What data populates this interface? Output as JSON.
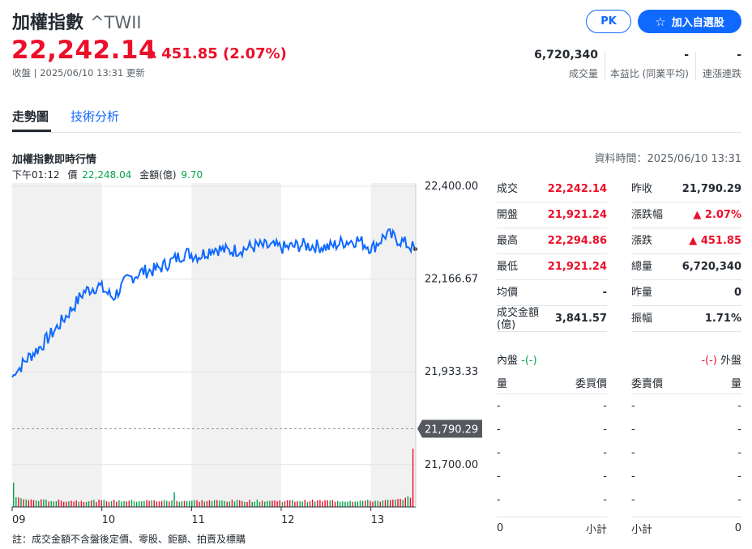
{
  "header": {
    "name": "加權指數",
    "symbol": "^TWII",
    "price": "22,242.14",
    "change_arrow": "▲",
    "change": "451.85 (2.07%)",
    "updated": "收盤 | 2025/06/10 13:31 更新",
    "pk_label": "PK",
    "add_icon": "star-outline-icon",
    "add_label": "加入自選股"
  },
  "stats": [
    {
      "value": "6,720,340",
      "label": "成交量"
    },
    {
      "value": "-",
      "label": "本益比 (同業平均)"
    },
    {
      "value": "-",
      "label": "連漲連跌"
    }
  ],
  "tabs": {
    "active": "走勢圖",
    "other": "技術分析"
  },
  "chart_header": {
    "title": "加權指數即時行情",
    "time": "資料時間：2025/06/10 13:31",
    "hover_time": "下午01:12",
    "price_label": "價",
    "price_value": "22,248.04",
    "amount_label": "金額(億)",
    "amount_value": "9.70"
  },
  "quote_left": [
    {
      "label": "成交",
      "value": "22,242.14",
      "color": "red"
    },
    {
      "label": "開盤",
      "value": "21,921.24",
      "color": "red"
    },
    {
      "label": "最高",
      "value": "22,294.86",
      "color": "red"
    },
    {
      "label": "最低",
      "value": "21,921.24",
      "color": "red"
    },
    {
      "label": "均價",
      "value": "-",
      "color": "black"
    },
    {
      "label": "成交金額\n(億)",
      "value": "3,841.57",
      "color": "black"
    }
  ],
  "quote_right": [
    {
      "label": "昨收",
      "value": "21,790.29",
      "color": "black"
    },
    {
      "label": "漲跌幅",
      "value": "▲ 2.07%",
      "color": "red"
    },
    {
      "label": "漲跌",
      "value": "▲ 451.85",
      "color": "red"
    },
    {
      "label": "總量",
      "value": "6,720,340",
      "color": "black"
    },
    {
      "label": "昨量",
      "value": "0",
      "color": "black"
    },
    {
      "label": "振幅",
      "value": "1.71%",
      "color": "black"
    }
  ],
  "orderbook": {
    "inner_label": "內盤",
    "inner_value": "-(-)",
    "outer_value": "-(-)",
    "outer_label": "外盤",
    "columns": [
      "量",
      "委買價",
      "委賣價",
      "量"
    ],
    "rows": [
      [
        "-",
        "-",
        "-",
        "-"
      ],
      [
        "-",
        "-",
        "-",
        "-"
      ],
      [
        "-",
        "-",
        "-",
        "-"
      ],
      [
        "-",
        "-",
        "-",
        "-"
      ],
      [
        "-",
        "-",
        "-",
        "-"
      ]
    ],
    "footer": [
      "0",
      "小計",
      "小計",
      "0"
    ]
  },
  "note": "註：成交金額不含盤後定價、零股、鉅額、拍賣及標購",
  "chart_data": {
    "type": "line",
    "x_start": "09:00",
    "x_end": "13:30",
    "x_ticks": [
      "09",
      "10",
      "11",
      "12",
      "13"
    ],
    "y_ticks": [
      "22,400.00",
      "22,166.67",
      "21,933.33",
      "21,700.00"
    ],
    "ylim": [
      21610,
      22400
    ],
    "prev_close": 21790.29,
    "prev_close_label": "21,790.29",
    "series": [
      {
        "values": [
          21920,
          21965,
          21998,
          22040,
          22085,
          22135,
          22150,
          22120,
          22165,
          22185,
          22190,
          22210,
          22232,
          22225,
          22245,
          22237,
          22242,
          22250,
          22248,
          22245,
          22252,
          22250,
          22247,
          22260,
          22265,
          22244,
          22280,
          22262,
          22242
        ],
        "color": "#0f69ff"
      }
    ],
    "volume_profile": [
      0.9,
      0.6,
      0.55,
      0.5,
      0.5,
      0.5,
      0.5,
      0.5,
      0.5,
      0.5,
      0.5,
      0.5,
      0.5,
      0.5,
      0.5,
      0.5,
      0.5,
      0.5,
      0.5,
      0.5,
      0.5,
      0.5,
      0.5,
      0.5,
      0.5,
      0.5,
      0.5,
      0.6,
      1.0
    ],
    "colors": {
      "up": "#eb0f29",
      "down": "#00a34a",
      "line": "#0f69ff",
      "band": "#f1f1f1"
    }
  }
}
